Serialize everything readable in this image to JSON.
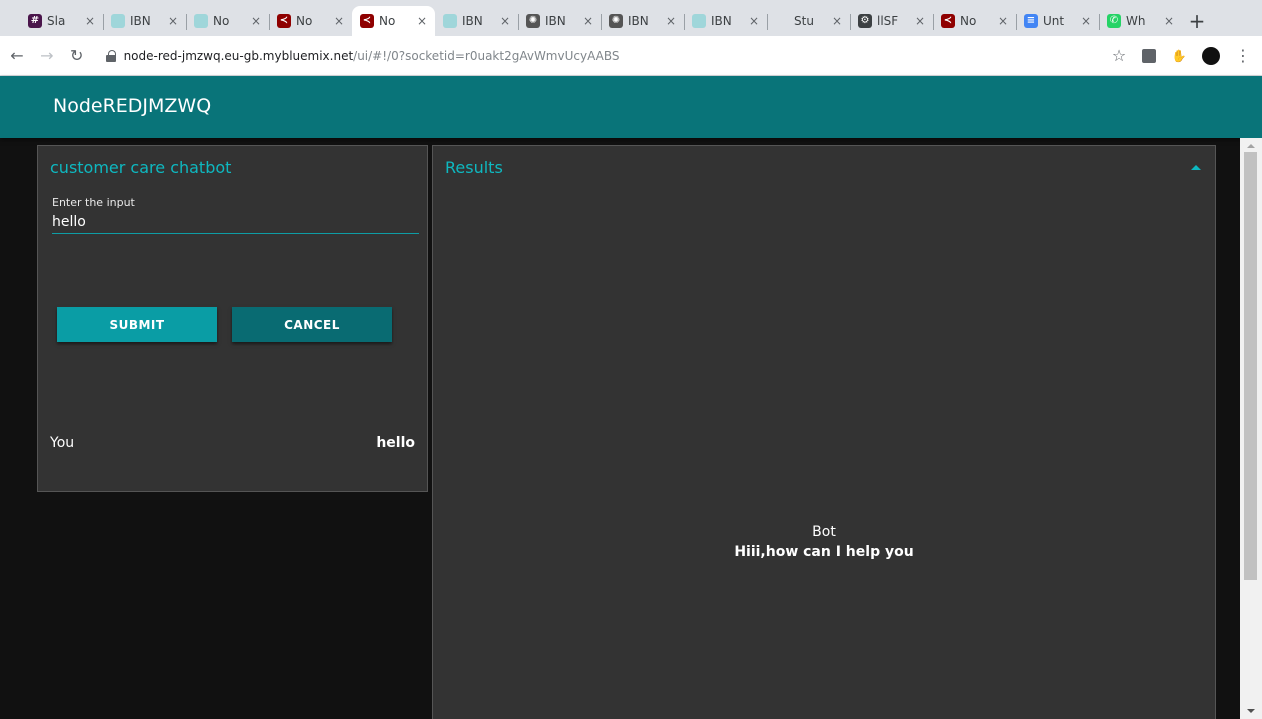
{
  "browser": {
    "tabs": [
      {
        "title": "Sla",
        "icon": "slack-icon",
        "color": "#4a154b",
        "glyph": "#"
      },
      {
        "title": "IBN",
        "icon": "ibm-cloud-icon",
        "color": "#9fd6da",
        "glyph": ""
      },
      {
        "title": "No",
        "icon": "ibm-cloud-icon",
        "color": "#9fd6da",
        "glyph": ""
      },
      {
        "title": "No",
        "icon": "node-red-icon",
        "color": "#8f0000",
        "glyph": "≺"
      },
      {
        "title": "No",
        "icon": "node-red-icon",
        "color": "#8f0000",
        "glyph": "≺",
        "active": true
      },
      {
        "title": "IBN",
        "icon": "ibm-cloud-icon",
        "color": "#9fd6da",
        "glyph": ""
      },
      {
        "title": "IBN",
        "icon": "watson-icon",
        "color": "#555555",
        "glyph": "✺"
      },
      {
        "title": "IBN",
        "icon": "watson-icon",
        "color": "#555555",
        "glyph": "✺"
      },
      {
        "title": "IBN",
        "icon": "ibm-cloud-icon",
        "color": "#9fd6da",
        "glyph": ""
      },
      {
        "title": "Stu",
        "icon": "blank-page-icon",
        "color": "#dee1e6",
        "glyph": ""
      },
      {
        "title": "llSF",
        "icon": "gear-box-icon",
        "color": "#3c4043",
        "glyph": "⚙"
      },
      {
        "title": "No",
        "icon": "node-red-icon",
        "color": "#8f0000",
        "glyph": "≺"
      },
      {
        "title": "Unt",
        "icon": "google-docs-icon",
        "color": "#4285f4",
        "glyph": "≡"
      },
      {
        "title": "Wh",
        "icon": "whatsapp-icon",
        "color": "#25d366",
        "glyph": "✆"
      }
    ],
    "new_tab_glyph": "+",
    "url_host": "node-red-jmzwq.eu-gb.mybluemix.net",
    "url_path": "/ui/#!/0?socketid=r0uakt2gAvWmvUcyAABS"
  },
  "app": {
    "title": "NodeREDJMZWQ",
    "accent": "#097479"
  },
  "chat_card": {
    "title": "customer care chatbot",
    "input_label": "Enter the input",
    "input_value": "hello",
    "submit_label": "SUBMIT",
    "cancel_label": "CANCEL",
    "you_label": "You",
    "you_value": "hello"
  },
  "results_card": {
    "title": "Results",
    "bot_label": "Bot",
    "bot_message": "Hiii,how can I help you"
  }
}
